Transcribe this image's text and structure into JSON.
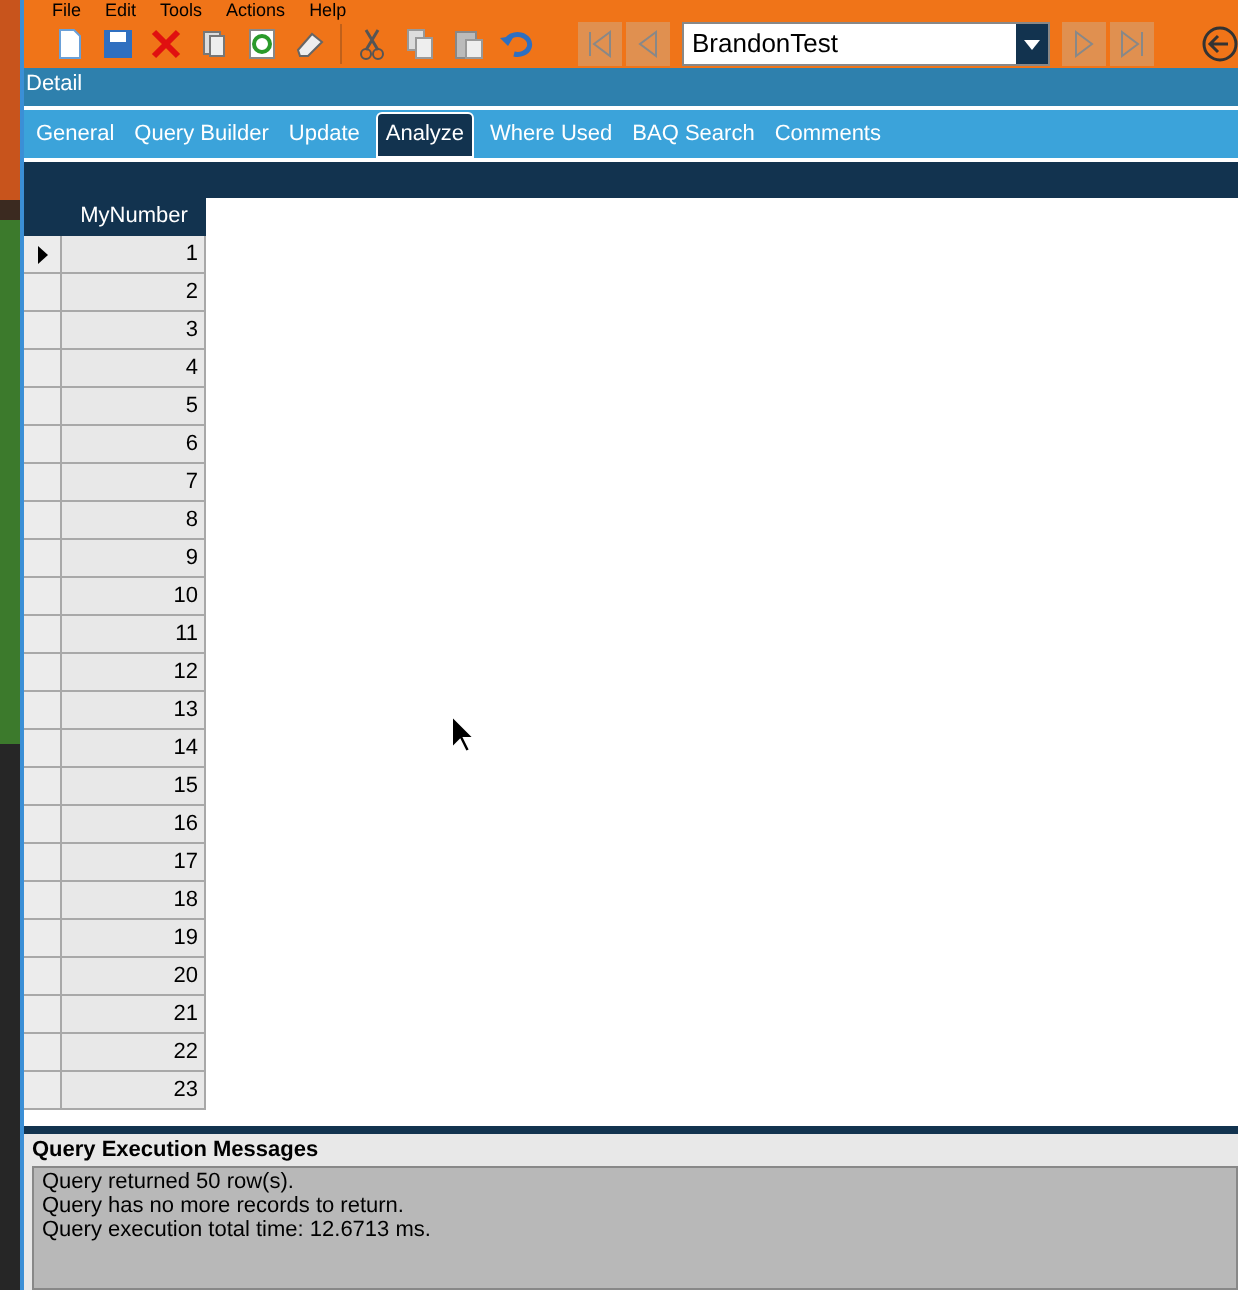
{
  "menu": [
    "File",
    "Edit",
    "Tools",
    "Actions",
    "Help"
  ],
  "record_selector": {
    "value": "BrandonTest"
  },
  "detail_title": "Detail",
  "tabs": [
    {
      "label": "General",
      "selected": false
    },
    {
      "label": "Query Builder",
      "selected": false
    },
    {
      "label": "Update",
      "selected": false
    },
    {
      "label": "Analyze",
      "selected": true
    },
    {
      "label": "Where Used",
      "selected": false
    },
    {
      "label": "BAQ Search",
      "selected": false
    },
    {
      "label": "Comments",
      "selected": false
    }
  ],
  "grid": {
    "columns": [
      "MyNumber"
    ],
    "rows": [
      {
        "cells": [
          "1"
        ],
        "selected": true
      },
      {
        "cells": [
          "2"
        ],
        "selected": false
      },
      {
        "cells": [
          "3"
        ],
        "selected": false
      },
      {
        "cells": [
          "4"
        ],
        "selected": false
      },
      {
        "cells": [
          "5"
        ],
        "selected": false
      },
      {
        "cells": [
          "6"
        ],
        "selected": false
      },
      {
        "cells": [
          "7"
        ],
        "selected": false
      },
      {
        "cells": [
          "8"
        ],
        "selected": false
      },
      {
        "cells": [
          "9"
        ],
        "selected": false
      },
      {
        "cells": [
          "10"
        ],
        "selected": false
      },
      {
        "cells": [
          "11"
        ],
        "selected": false
      },
      {
        "cells": [
          "12"
        ],
        "selected": false
      },
      {
        "cells": [
          "13"
        ],
        "selected": false
      },
      {
        "cells": [
          "14"
        ],
        "selected": false
      },
      {
        "cells": [
          "15"
        ],
        "selected": false
      },
      {
        "cells": [
          "16"
        ],
        "selected": false
      },
      {
        "cells": [
          "17"
        ],
        "selected": false
      },
      {
        "cells": [
          "18"
        ],
        "selected": false
      },
      {
        "cells": [
          "19"
        ],
        "selected": false
      },
      {
        "cells": [
          "20"
        ],
        "selected": false
      },
      {
        "cells": [
          "21"
        ],
        "selected": false
      },
      {
        "cells": [
          "22"
        ],
        "selected": false
      },
      {
        "cells": [
          "23"
        ],
        "selected": false
      }
    ]
  },
  "messages": {
    "title": "Query Execution Messages",
    "lines": [
      "Query returned 50 row(s).",
      "Query has no more records to return.",
      "Query execution total time: 12.6713 ms."
    ]
  }
}
